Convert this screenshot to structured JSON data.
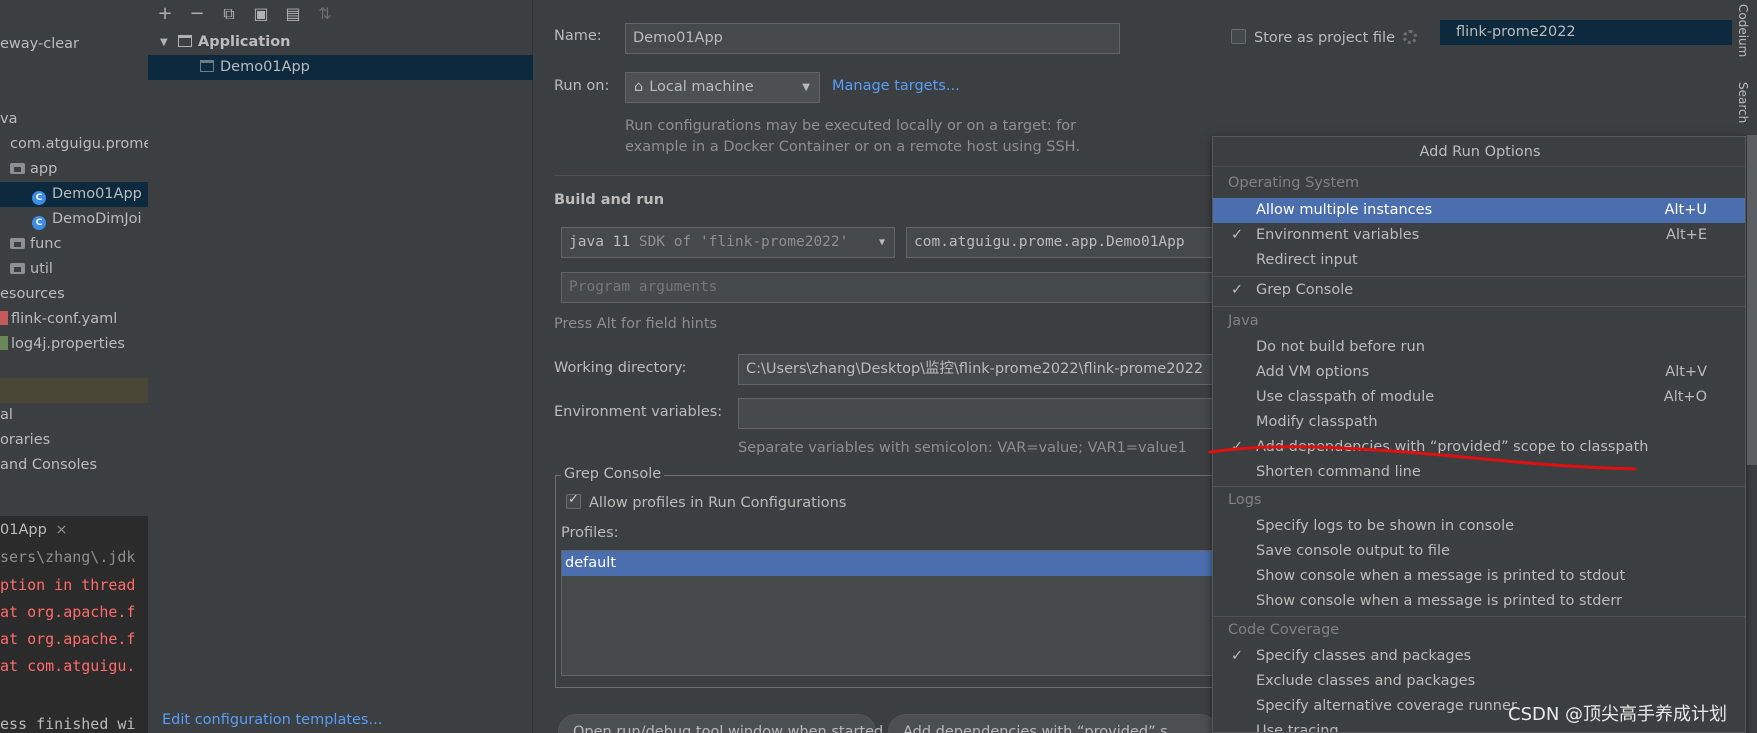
{
  "project_panel": {
    "items": [
      {
        "label": "eway-clear",
        "kind": "text"
      },
      {
        "label": "va",
        "kind": "text"
      },
      {
        "label": "com.atguigu.prome",
        "kind": "text"
      },
      {
        "label": "app",
        "kind": "folder"
      },
      {
        "label": "Demo01App",
        "kind": "class"
      },
      {
        "label": "DemoDimJoi",
        "kind": "class"
      },
      {
        "label": "func",
        "kind": "folder"
      },
      {
        "label": "util",
        "kind": "folder"
      },
      {
        "label": "esources",
        "kind": "text"
      },
      {
        "label": "flink-conf.yaml",
        "kind": "file"
      },
      {
        "label": "log4j.properties",
        "kind": "file-green"
      },
      {
        "label": "al",
        "kind": "text"
      },
      {
        "label": "oraries",
        "kind": "text"
      },
      {
        "label": "and Consoles",
        "kind": "text"
      }
    ]
  },
  "console": {
    "tab_label": "01App",
    "tab_close": "×",
    "lines": [
      {
        "text": "sers\\zhang\\.jdk",
        "color": "#8e8e8e"
      },
      {
        "text": "ption in thread",
        "color": "#ff6b68"
      },
      {
        "text": "at org.apache.f",
        "color": "#ff6b68"
      },
      {
        "text": "at org.apache.f",
        "color": "#ff6b68"
      },
      {
        "text": "at com.atguigu.",
        "color": "#ff6b68"
      },
      {
        "text": "ess finished wi",
        "color": "#bbbbbb"
      }
    ]
  },
  "config_tree": {
    "toolbar_icons": [
      "add-icon",
      "remove-icon",
      "copy-icon",
      "save-icon",
      "new-folder-icon",
      "sort-icon"
    ],
    "toolbar_glyphs": [
      "+",
      "−",
      "⧉",
      "▣",
      "▤",
      "⇅"
    ],
    "group_arrow": "▼",
    "group_label": "Application",
    "item_label": "Demo01App",
    "edit_templates": "Edit configuration templates..."
  },
  "form": {
    "name_label": "Name:",
    "name_value": "Demo01App",
    "store_label": "Store as project file",
    "run_on_label": "Run on:",
    "run_on_icon": "⌂",
    "run_on_value": "Local machine",
    "chevron": "▼",
    "manage_targets": "Manage targets...",
    "run_on_hint_1": "Run configurations may be executed locally or on a target: for",
    "run_on_hint_2": "example in a Docker Container or on a remote host using SSH.",
    "build_and_run": "Build and run",
    "sdk_value": "java 11",
    "sdk_detail": "SDK of 'flink-prome2022'",
    "main_class": "com.atguigu.prome.app.Demo01App",
    "program_args_placeholder": "Program arguments",
    "field_hint": "Press Alt for field hints",
    "working_dir_label": "Working directory:",
    "working_dir_value": "C:\\Users\\zhang\\Desktop\\监控\\flink-prome2022\\flink-prome2022",
    "env_vars_label": "Environment variables:",
    "env_vars_value": "",
    "env_vars_hint": "Separate variables with semicolon: VAR=value; VAR1=value1",
    "grep_console_title": "Grep Console",
    "allow_profiles": "Allow profiles in Run Configurations",
    "profiles_label": "Profiles:",
    "profiles": [
      "default"
    ],
    "pill_1": "Open run/debug tool window when started",
    "pill_1_close": "×",
    "pill_2": "Add dependencies with “provided” s"
  },
  "popup": {
    "title": "Add Run Options",
    "groups": [
      {
        "name": "Operating System",
        "items": [
          {
            "label": "Allow multiple instances",
            "shortcut": "Alt+U",
            "checked": false,
            "selected": true
          },
          {
            "label": "Environment variables",
            "shortcut": "Alt+E",
            "checked": true,
            "selected": false
          },
          {
            "label": "Redirect input",
            "shortcut": "",
            "checked": false,
            "selected": false
          }
        ]
      },
      {
        "name": "",
        "items": [
          {
            "label": "Grep Console",
            "shortcut": "",
            "checked": true,
            "selected": false
          }
        ]
      },
      {
        "name": "Java",
        "items": [
          {
            "label": "Do not build before run",
            "shortcut": "",
            "checked": false,
            "selected": false
          },
          {
            "label": "Add VM options",
            "shortcut": "Alt+V",
            "checked": false,
            "selected": false
          },
          {
            "label": "Use classpath of module",
            "shortcut": "Alt+O",
            "checked": false,
            "selected": false
          },
          {
            "label": "Modify classpath",
            "shortcut": "",
            "checked": false,
            "selected": false
          },
          {
            "label": "Add dependencies with “provided” scope to classpath",
            "shortcut": "",
            "checked": true,
            "selected": false
          },
          {
            "label": "Shorten command line",
            "shortcut": "",
            "checked": false,
            "selected": false
          }
        ]
      },
      {
        "name": "Logs",
        "items": [
          {
            "label": "Specify logs to be shown in console",
            "shortcut": "",
            "checked": false,
            "selected": false
          },
          {
            "label": "Save console output to file",
            "shortcut": "",
            "checked": false,
            "selected": false
          },
          {
            "label": "Show console when a message is printed to stdout",
            "shortcut": "",
            "checked": false,
            "selected": false
          },
          {
            "label": "Show console when a message is printed to stderr",
            "shortcut": "",
            "checked": false,
            "selected": false
          }
        ]
      },
      {
        "name": "Code Coverage",
        "items": [
          {
            "label": "Specify classes and packages",
            "shortcut": "",
            "checked": true,
            "selected": false
          },
          {
            "label": "Exclude classes and packages",
            "shortcut": "",
            "checked": false,
            "selected": false
          },
          {
            "label": "Specify alternative coverage runner",
            "shortcut": "",
            "checked": false,
            "selected": false
          },
          {
            "label": "Use tracing",
            "shortcut": "",
            "checked": false,
            "selected": false
          }
        ]
      }
    ],
    "checkmark": "✓"
  },
  "right_strip": {
    "top_item": "flink-prome2022",
    "tab_1": "Codeium",
    "tab_2": "Search"
  },
  "watermark": "CSDN @顶尖高手养成计划",
  "colors": {
    "accent_selection": "#4b6eaf",
    "link": "#589df6",
    "error_text": "#ff6b68",
    "annotation_red": "#e01010"
  }
}
